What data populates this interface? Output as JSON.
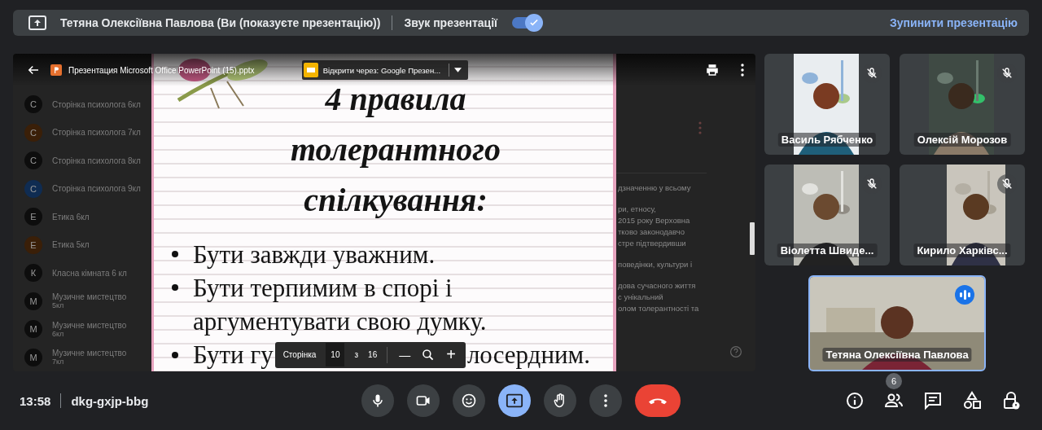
{
  "banner": {
    "presenter": "Тетяна Олексіївна Павлова (Ви (показуєте презентацію))",
    "audio_label": "Звук презентації",
    "audio_on": true,
    "stop": "Зупинити презентацію"
  },
  "viewer": {
    "file_name": "Презентация Microsoft Office PowerPoint (15).pptx",
    "open_with": "Відкрити через: Google Презен...",
    "list": [
      {
        "letter": "С",
        "title": "Сторінка психолога 6кл",
        "color": "#0d0d0d"
      },
      {
        "letter": "С",
        "title": "Сторінка психолога 7кл",
        "color": "#3a1f08"
      },
      {
        "letter": "С",
        "title": "Сторінка психолога 8кл",
        "color": "#0d0d0d"
      },
      {
        "letter": "С",
        "title": "Сторінка психолога 9кл",
        "color": "#0f2c52"
      },
      {
        "letter": "Е",
        "title": "Етика 6кл",
        "color": "#0d0d0d"
      },
      {
        "letter": "Е",
        "title": "Етика 5кл",
        "color": "#3a1f08"
      },
      {
        "letter": "К",
        "title": "Класна кімната 6 кл",
        "color": "#0d0d0d"
      },
      {
        "letter": "М",
        "title": "Музичне мистецтво",
        "sub": "5кл",
        "color": "#0d0d0d"
      },
      {
        "letter": "М",
        "title": "Музичне мистецтво",
        "sub": "6кл",
        "color": "#0d0d0d"
      },
      {
        "letter": "М",
        "title": "Музичне мистецтво",
        "sub": "7кл",
        "color": "#0d0d0d"
      }
    ],
    "side_text": [
      [
        "дзначенню у всьому"
      ],
      [
        "ри, етносу,",
        "2015 року Верховна",
        "тково законодавчо",
        "стре підтвердивши"
      ],
      [
        "поведінки, культури і"
      ],
      [
        "дова сучасного життя",
        "с унікальний",
        "олом толерантності та"
      ]
    ],
    "page_label": "Сторінка",
    "page": "10",
    "page_of": "з",
    "pages": "16",
    "zoom_out": "—",
    "zoom_in": "+"
  },
  "slide": {
    "title": [
      "4 правила",
      "толерантного",
      "спілкування:"
    ],
    "bullets": [
      {
        "kind": "lines",
        "texts": [
          "Бути завжди уважним."
        ]
      },
      {
        "kind": "lines",
        "texts": [
          "Бути терпимим в спорі і",
          "аргументувати  свою думку."
        ]
      },
      {
        "kind": "covered",
        "texts": [
          "Бути гу",
          "лосердним."
        ]
      }
    ]
  },
  "participants": [
    {
      "name": "Василь Рябченко",
      "muted": true
    },
    {
      "name": "Олексій Морозов",
      "muted": true
    },
    {
      "name": "Віолетта Швиде...",
      "muted": true
    },
    {
      "name": "Кирило Харківс...",
      "muted": true
    }
  ],
  "speaker": {
    "name": "Тетяна Олексіївна Павлова",
    "speaking": true
  },
  "meeting": {
    "time": "13:58",
    "code": "dkg-gxjp-bbg"
  },
  "controls": [
    {
      "kind": "mic",
      "on": false
    },
    {
      "kind": "camera",
      "on": false
    },
    {
      "kind": "emoji",
      "on": false
    },
    {
      "kind": "present",
      "on": true
    },
    {
      "kind": "hand",
      "on": false
    },
    {
      "kind": "more",
      "on": false
    },
    {
      "kind": "end"
    }
  ],
  "side_controls": [
    {
      "kind": "info"
    },
    {
      "kind": "people",
      "badge": "6"
    },
    {
      "kind": "chat"
    },
    {
      "kind": "activities"
    },
    {
      "kind": "safety"
    }
  ]
}
